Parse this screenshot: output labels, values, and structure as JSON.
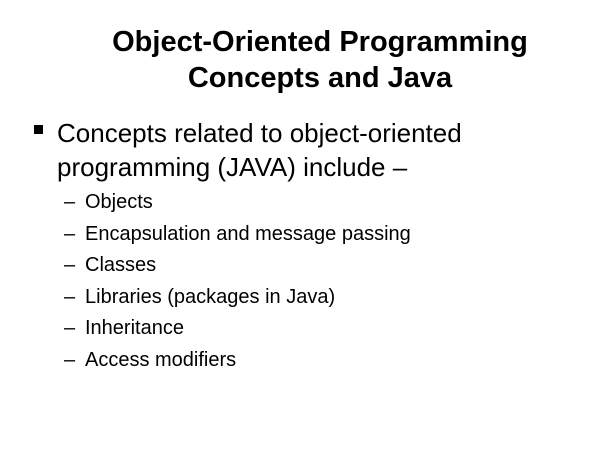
{
  "slide": {
    "title_lines": [
      "Object-Oriented Programming",
      "Concepts and Java"
    ],
    "main_bullet": {
      "lines": [
        "Concepts related to object-oriented",
        "programming (JAVA) include –"
      ]
    },
    "sub_bullets": [
      {
        "dash": "–",
        "text": "Objects"
      },
      {
        "dash": "–",
        "text": "Encapsulation and message passing"
      },
      {
        "dash": "–",
        "text": "Classes"
      },
      {
        "dash": "–",
        "text": "Libraries (packages in Java)"
      },
      {
        "dash": "–",
        "text": "Inheritance"
      },
      {
        "dash": "–",
        "text": "Access modifiers"
      }
    ]
  }
}
